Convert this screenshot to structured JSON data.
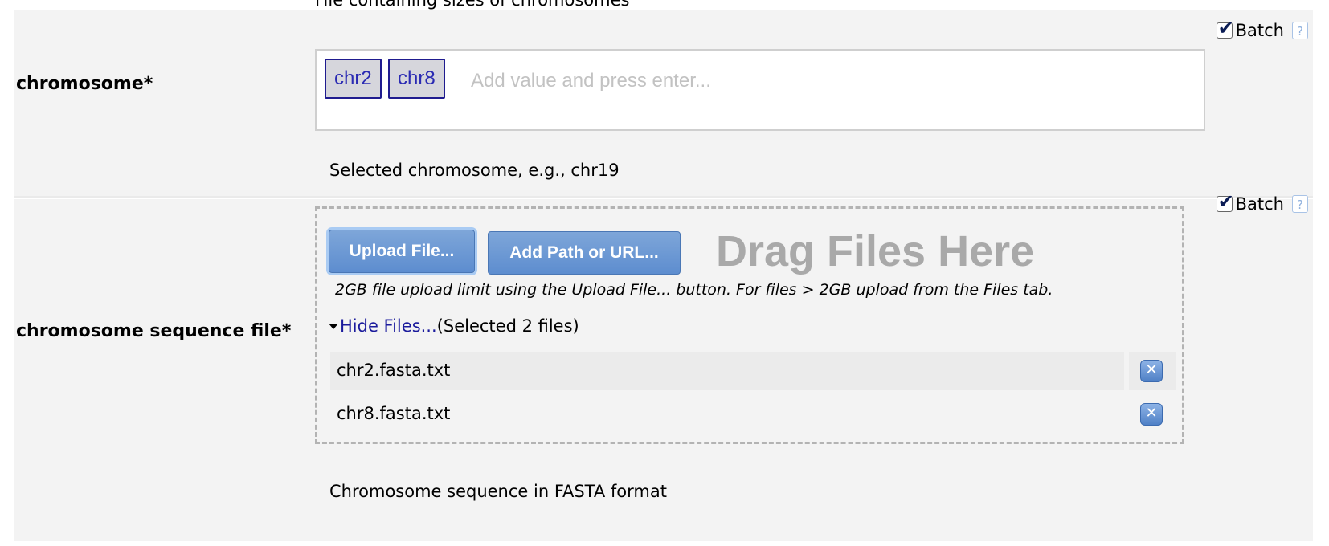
{
  "top_help": "File containing sizes of chromosomes",
  "chromosome": {
    "label": "chromosome*",
    "batch_label": "Batch",
    "batch_checked": true,
    "help_icon": "?",
    "tags": [
      "chr2",
      "chr8"
    ],
    "input_placeholder": "Add value and press enter...",
    "help": "Selected chromosome, e.g., chr19"
  },
  "sequence_file": {
    "label": "chromosome sequence file*",
    "batch_label": "Batch",
    "batch_checked": true,
    "help_icon": "?",
    "upload_button": "Upload File...",
    "add_path_button": "Add Path or URL...",
    "drag_text": "Drag Files Here",
    "upload_note": "2GB file upload limit using the Upload File... button. For files > 2GB upload from the Files tab.",
    "hide_files_link": "Hide Files...",
    "selected_count": "(Selected 2 files)",
    "files": [
      {
        "name": "chr2.fasta.txt",
        "remove_icon": "✕"
      },
      {
        "name": "chr8.fasta.txt",
        "remove_icon": "✕"
      }
    ],
    "help": "Chromosome sequence in FASTA format"
  },
  "colors": {
    "row_bg": "#f3f3f3",
    "tag_border": "#1f1b8f",
    "tag_text": "#2a2ab3",
    "button_blue": "#5d8dcf",
    "link": "#1a1a9c"
  }
}
